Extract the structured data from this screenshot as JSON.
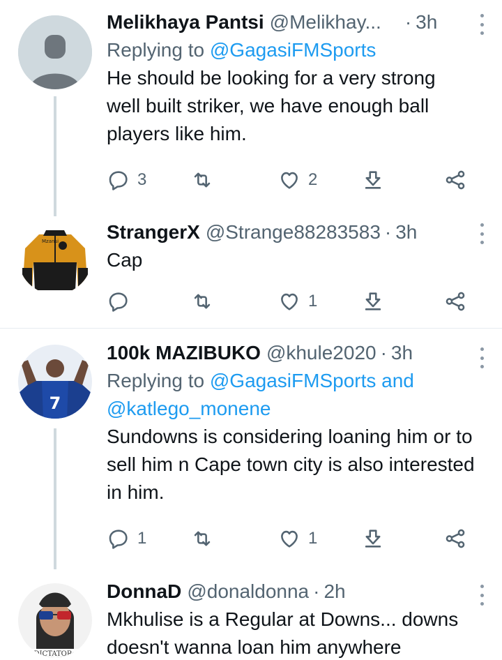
{
  "tweets": [
    {
      "name": "Melikhaya Pantsi",
      "handle": "@Melikhay...",
      "dot": "·",
      "time": "3h",
      "replying_prefix": "Replying to",
      "replying_line1": "@GagasiFMSports",
      "replying_line2": "",
      "text": "He should be looking for a very strong well built striker, we have enough ball players like him.",
      "replies": "3",
      "retweets": "",
      "likes": "2"
    },
    {
      "name": "StrangerX",
      "handle": "@Strange88283583",
      "dot": "·",
      "time": "3h",
      "text": "Cap",
      "replies": "",
      "retweets": "",
      "likes": "1"
    },
    {
      "name": "100k MAZIBUKO",
      "handle": "@khule2020",
      "dot": "·",
      "time": "3h",
      "replying_prefix": "Replying to",
      "replying_line1": "@GagasiFMSports and",
      "replying_line2": "@katlego_monene",
      "text": "Sundowns is considering loaning him or to sell him n Cape town city is also interested in him.",
      "replies": "1",
      "retweets": "",
      "likes": "1"
    },
    {
      "name": "DonnaD",
      "handle": "@donaldonna",
      "dot": "·",
      "time": "2h",
      "text": "Mkhulise is a Regular at Downs... downs doesn't wanna loan him anywhere"
    }
  ],
  "avatars": {
    "strangerx_jacket_text": "Mzansi",
    "mazibuko_jersey_number": "7",
    "donna_poster_text": "DICTATOR"
  },
  "colors": {
    "link": "#1d9bf0",
    "secondary_text": "#536471",
    "thread_line": "#cfd9de"
  },
  "icons": [
    "reply-icon",
    "retweet-icon",
    "like-icon",
    "bookmark-icon",
    "share-icon",
    "more-icon"
  ]
}
